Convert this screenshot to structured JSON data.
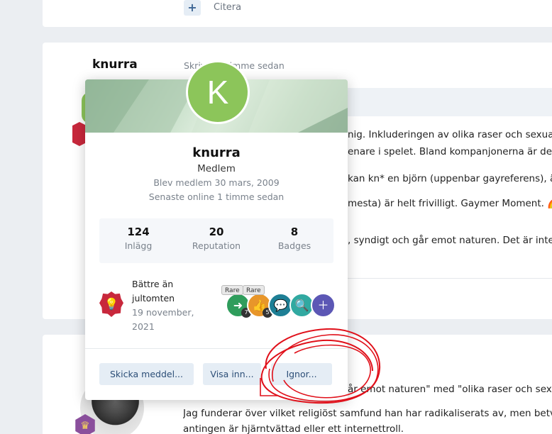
{
  "top_post": {
    "quote_icon": "+",
    "quote_label": "Citera"
  },
  "post": {
    "author": "knurra",
    "time": "Skrivet 1 timme sedan",
    "lines": [
      "nig. Inkluderingen av olika raser och sexualit",
      "enare i spelet. Bland kompanjonerna är det k",
      "kan kn* en björn (uppenbar gayreferens), äv",
      "mesta) är helt frivilligt. Gaymer Moment. 🌈",
      ", syndigt och går emot naturen. Det är inte G"
    ]
  },
  "next_post": {
    "line1": "år emot naturen\" med \"olika raser och sexua",
    "line2": "Jag funderar över vilket religiöst samfund han har radikaliserats av, men betviv",
    "line3": "antingen är hjärntvättad eller ett internettroll."
  },
  "popup": {
    "avatar_letter": "K",
    "name": "knurra",
    "role": "Medlem",
    "joined": "Blev medlem 30 mars, 2009",
    "online": "Senaste online 1 timme sedan",
    "stats": [
      {
        "value": "124",
        "label": "Inlägg"
      },
      {
        "value": "20",
        "label": "Reputation"
      },
      {
        "value": "8",
        "label": "Badges"
      }
    ],
    "rank": {
      "title": "Bättre än jultomten",
      "date": "19 november, 2021"
    },
    "badges": {
      "rare_label": "Rare",
      "count_1": "7",
      "count_2": "5"
    },
    "buttons": {
      "message": "Skicka meddel...",
      "view": "Visa inn...",
      "ignore": "Ignor..."
    }
  },
  "colors": {
    "avatar_green": "#8cc55a",
    "rank_red": "#c8283c",
    "button_bg": "#e5edf5",
    "annotation_red": "#e0101a"
  }
}
